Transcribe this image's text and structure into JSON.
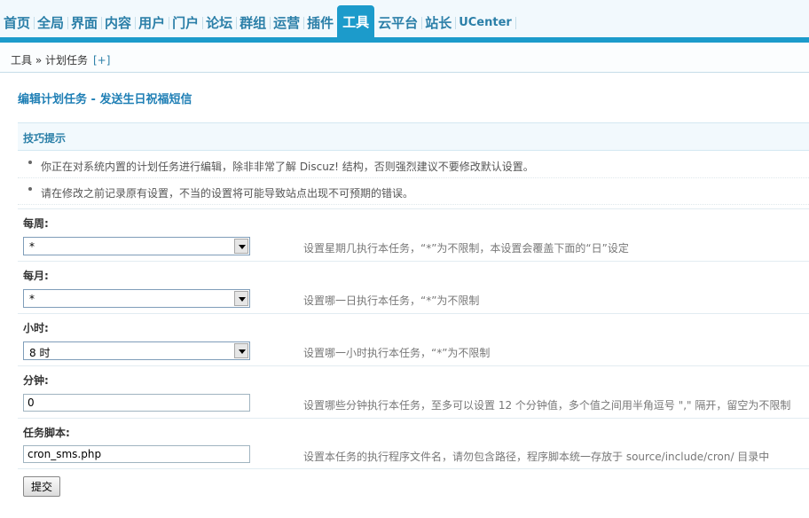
{
  "nav": {
    "items": [
      "首页",
      "全局",
      "界面",
      "内容",
      "用户",
      "门户",
      "论坛",
      "群组",
      "运营",
      "插件",
      "工具",
      "云平台",
      "站长",
      "UCenter"
    ],
    "active": "工具"
  },
  "breadcrumb": {
    "path": "工具 » 计划任务",
    "add": "[+]"
  },
  "page": {
    "title": "编辑计划任务 - 发送生日祝福短信"
  },
  "tips": {
    "heading": "技巧提示",
    "items": [
      "你正在对系统内置的计划任务进行编辑，除非非常了解 Discuz! 结构，否则强烈建议不要修改默认设置。",
      "请在修改之前记录原有设置，不当的设置将可能导致站点出现不可预期的错误。"
    ]
  },
  "form": {
    "weekday": {
      "label": "每周:",
      "value": "*",
      "hint": "设置星期几执行本任务，“*”为不限制，本设置会覆盖下面的“日”设定"
    },
    "day": {
      "label": "每月:",
      "value": "*",
      "hint": "设置哪一日执行本任务，“*”为不限制"
    },
    "hour": {
      "label": "小时:",
      "value": "8 时",
      "hint": "设置哪一小时执行本任务，“*”为不限制"
    },
    "minute": {
      "label": "分钟:",
      "value": "0",
      "hint": "设置哪些分钟执行本任务，至多可以设置 12 个分钟值，多个值之间用半角逗号 \",\" 隔开，留空为不限制"
    },
    "script": {
      "label": "任务脚本:",
      "value": "cron_sms.php",
      "hint": "设置本任务的执行程序文件名，请勿包含路径，程序脚本统一存放于 source/include/cron/ 目录中"
    },
    "submit_label": "提交"
  },
  "colors": {
    "accent": "#1c9bcb",
    "title": "#1f7fb5",
    "nav_text": "#2b7fa8"
  }
}
